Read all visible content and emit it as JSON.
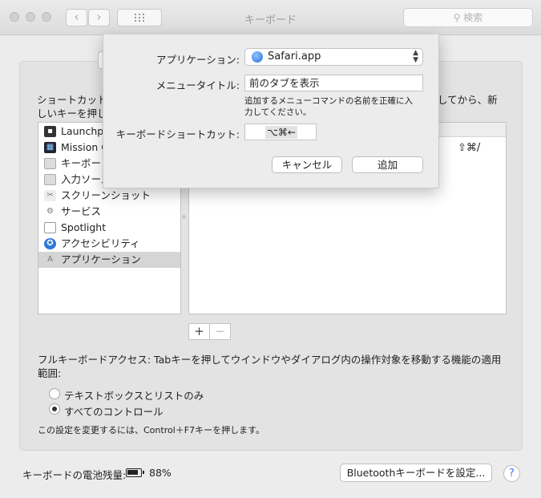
{
  "window": {
    "title": "キーボード",
    "search_placeholder": "検索"
  },
  "nav": {
    "back_glyph": "‹",
    "forward_glyph": "›"
  },
  "panel": {
    "description": "ショートカット\nしいキーを押し",
    "description_right": "してから、新",
    "categories": [
      {
        "label": "Launchpad",
        "icon": "launchpad-icon"
      },
      {
        "label": "Mission Control",
        "icon": "mission-control-icon"
      },
      {
        "label": "キーボード",
        "icon": "keyboard-icon"
      },
      {
        "label": "入力ソース",
        "icon": "input-sources-icon"
      },
      {
        "label": "スクリーンショット",
        "icon": "screenshot-icon"
      },
      {
        "label": "サービス",
        "icon": "services-gear-icon"
      },
      {
        "label": "Spotlight",
        "icon": "spotlight-icon"
      },
      {
        "label": "アクセシビリティ",
        "icon": "accessibility-icon"
      },
      {
        "label": "アプリケーション",
        "icon": "applications-icon",
        "selected": true
      }
    ],
    "right_shortcut": "⇧⌘/",
    "plus": "+",
    "minus": "−"
  },
  "fka": {
    "text": "フルキーボードアクセス: Tabキーを押してウインドウやダイアログ内の操作対象を移動する機能の適用範囲:",
    "options": [
      "テキストボックスとリストのみ",
      "すべてのコントロール"
    ],
    "selected_index": 1,
    "note": "この設定を変更するには、Control＋F7キーを押します。"
  },
  "footer": {
    "battery_label": "キーボードの電池残量:",
    "battery_percent": "88%",
    "bt_button": "Bluetoothキーボードを設定...",
    "help": "?"
  },
  "sheet": {
    "app_label": "アプリケーション:",
    "app_value": "Safari.app",
    "menu_label": "メニュータイトル:",
    "menu_value": "前のタブを表示",
    "hint": "追加するメニューコマンドの名前を正確に入力してください。",
    "shortcut_label": "キーボードショートカット:",
    "shortcut_value": "⌥⌘←",
    "cancel": "キャンセル",
    "add": "追加"
  }
}
